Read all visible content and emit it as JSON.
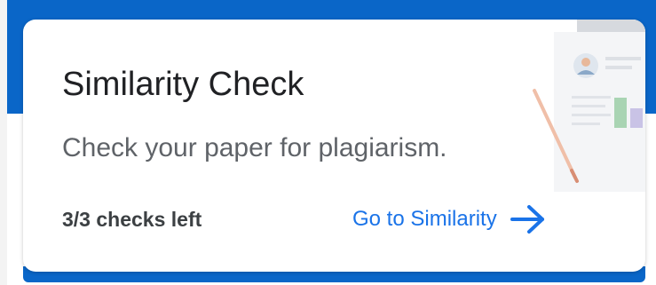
{
  "card": {
    "title": "Similarity Check",
    "subtitle": "Check your paper for plagiarism.",
    "checks_left": "3/3 checks left",
    "link_label": "Go to Similarity"
  },
  "icons": {
    "link_arrow": "arrow-right-icon",
    "illustration": "document-report-illustration"
  },
  "colors": {
    "brand_blue": "#0a66c8",
    "link_blue": "#1a73e8",
    "title_text": "#202124",
    "subtitle_text": "#5f6368"
  }
}
